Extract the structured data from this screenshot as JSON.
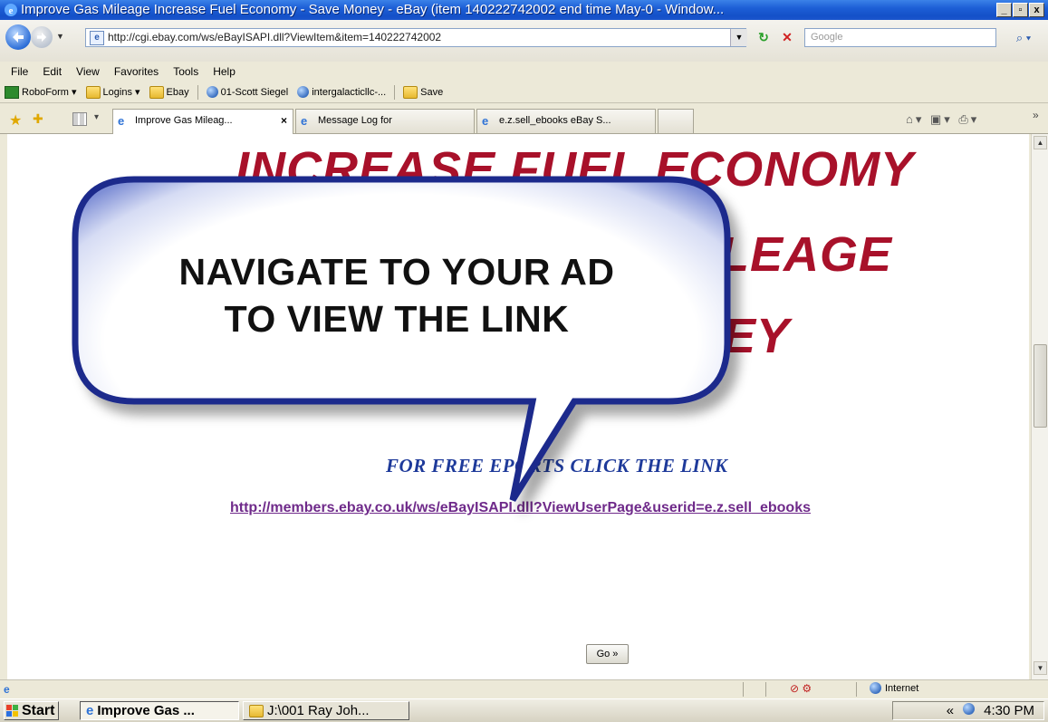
{
  "window": {
    "title": "Improve Gas Mileage Increase Fuel Economy - Save Money - eBay (item 140222742002 end time May-0 - Window...",
    "controls": {
      "minimize": "_",
      "maximize": "▫",
      "close": "x"
    }
  },
  "address_bar": {
    "url": "http://cgi.ebay.com/ws/eBayISAPI.dll?ViewItem&item=140222742002",
    "search_placeholder": "Google"
  },
  "menu": [
    "File",
    "Edit",
    "View",
    "Favorites",
    "Tools",
    "Help"
  ],
  "links_toolbar": {
    "roboform": "RoboForm ▾",
    "logins": "Logins ▾",
    "ebay": "Ebay",
    "scott": "01-Scott Siegel",
    "intergalactic": "intergalacticllc-...",
    "save": "Save"
  },
  "tabs": [
    {
      "label": "Improve Gas Mileag...",
      "active": true,
      "close": "×"
    },
    {
      "label": "Message Log for",
      "active": false
    },
    {
      "label": "e.z.sell_ebooks eBay S...",
      "active": false
    }
  ],
  "page": {
    "headline_line1": "INCREASE FUEL ECONOMY",
    "headline_line2_fragment": "ILEAGE",
    "headline_line3_fragment": "EY",
    "free_reports": "FOR  FREE  EPORTS CLICK THE LINK",
    "link": "http://members.ebay.co.uk/ws/eBayISAPI.dll?ViewUserPage&userid=e.z.sell_ebooks",
    "go_button": "Go »",
    "callout": {
      "line1": "NAVIGATE TO YOUR AD",
      "line2": "TO VIEW THE LINK"
    }
  },
  "status_bar": {
    "zone": "Internet"
  },
  "taskbar": {
    "start": "Start",
    "items": [
      "Improve Gas ...",
      "J:\\001 Ray Joh..."
    ],
    "tray_chevron": "«",
    "time": "4:30 PM"
  },
  "colors": {
    "headline": "#a8112a",
    "free_reports": "#1e3a9a",
    "link": "#6f2a8a",
    "callout_border": "#1c2a8c"
  }
}
